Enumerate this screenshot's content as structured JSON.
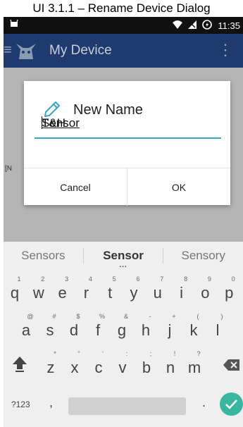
{
  "caption": "UI 3.1.1 – Rename Device Dialog",
  "status_bar": {
    "time": "11:35"
  },
  "app_bar": {
    "title": "My Device"
  },
  "background": {
    "partial_text": "[N"
  },
  "dialog": {
    "title": "New Name",
    "input_value_prefix": "T&H ",
    "input_value_word": "Sensor",
    "cancel_label": "Cancel",
    "ok_label": "OK"
  },
  "keyboard": {
    "suggestions": [
      "Sensors",
      "Sensor",
      "Sensory"
    ],
    "suggestion_dots": "...",
    "row1": [
      {
        "key": "q",
        "hint": "1"
      },
      {
        "key": "w",
        "hint": "2"
      },
      {
        "key": "e",
        "hint": "3"
      },
      {
        "key": "r",
        "hint": "4"
      },
      {
        "key": "t",
        "hint": "5"
      },
      {
        "key": "y",
        "hint": "6"
      },
      {
        "key": "u",
        "hint": "7"
      },
      {
        "key": "i",
        "hint": "8"
      },
      {
        "key": "o",
        "hint": "9"
      },
      {
        "key": "p",
        "hint": "0"
      }
    ],
    "row2": [
      {
        "key": "a",
        "hint": "@"
      },
      {
        "key": "s",
        "hint": "#"
      },
      {
        "key": "d",
        "hint": "$"
      },
      {
        "key": "f",
        "hint": "%"
      },
      {
        "key": "g",
        "hint": "&"
      },
      {
        "key": "h",
        "hint": "-"
      },
      {
        "key": "j",
        "hint": "+"
      },
      {
        "key": "k",
        "hint": "("
      },
      {
        "key": "l",
        "hint": ")"
      }
    ],
    "row3": [
      {
        "key": "z",
        "hint": "*"
      },
      {
        "key": "x",
        "hint": "\""
      },
      {
        "key": "c",
        "hint": "'"
      },
      {
        "key": "v",
        "hint": ":"
      },
      {
        "key": "b",
        "hint": ";"
      },
      {
        "key": "n",
        "hint": "!"
      },
      {
        "key": "m",
        "hint": "?"
      }
    ],
    "symbols_label": "?123",
    "comma": ",",
    "period": "."
  },
  "colors": {
    "app_bar": "#1e3a6e",
    "accent": "#3aa3c8",
    "enter_key": "#38b6a0"
  }
}
